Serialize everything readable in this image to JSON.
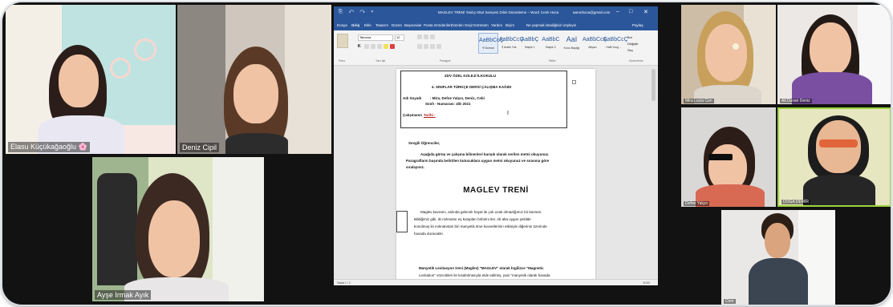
{
  "participants": {
    "p1": {
      "name": "Elasu Küçükağaoğlu 🌸"
    },
    "p2": {
      "name": "Deniz Cipil"
    },
    "p3": {
      "name": "Ayşe Irmak Ayık"
    },
    "p4": {
      "name": "Mira Lucia Cen"
    },
    "p5": {
      "name": "All Duvan Deniz"
    },
    "p6": {
      "name": "Defne Yalçın"
    },
    "p7": {
      "name": "DOĞA DEMİR"
    },
    "p8": {
      "name": "Cem"
    }
  },
  "word": {
    "title": "MAGLEV TRENİ Yanlış Okul Seviyesi Dilini Düzenleme – Word",
    "user": "Cenk Hoca",
    "account": "aaronhoca@gmail.com",
    "tabs": [
      "Dosya",
      "Giriş",
      "Ekle",
      "Tasarım",
      "Düzen",
      "Başvurular",
      "Posta Gönderileri",
      "Gözden Geçir",
      "Görünüm",
      "Yardım",
      "Biçim",
      "Ne yapmak istediğinizi söyleyin",
      "Paylaş"
    ],
    "clipboard_label": "Pano",
    "font_name": "Tahoma",
    "font_size": "12",
    "font_label": "Yazı tipi",
    "paragraph_label": "Paragraf",
    "styles_label": "Stiller",
    "styles": [
      {
        "preview": "AaBbCcÇ",
        "name": "¶ Normal"
      },
      {
        "preview": "AaBbCcÇ",
        "name": "¶ Aralık Yok"
      },
      {
        "preview": "AaBbÇ",
        "name": "Başlık 1"
      },
      {
        "preview": "AaBbC",
        "name": "Başlık 2"
      },
      {
        "preview": "AaI",
        "name": "Konu Başlığı"
      },
      {
        "preview": "AaBbCcÇ",
        "name": "Altyazı"
      },
      {
        "preview": "AaBbCcÇ",
        "name": "Hafif Vurg..."
      }
    ],
    "editing": {
      "find": "Bul",
      "replace": "Değiştir",
      "select": "Seç"
    },
    "editing_label": "Düzenleme",
    "status_left": "Sayfa 1 / 2",
    "status_right": "%100",
    "doc": {
      "school": "ZDV ÖZEL KOLEJİ İLKOKULU",
      "worksheet": "4. SINIFLAR TÜRKÇE DERSİ ÇALIŞMA KAĞIDI",
      "name_label": "Adı Soyadı",
      "name_value": ": Mira, Defne Yalçın, Deniz, Cebi",
      "class_label": "Sınıfı - Numarası: 4/D 2021",
      "date_label": "Çalışmanın",
      "date_value": "Tarihi :",
      "greeting": "Sevgili Öğrenciler,",
      "instr1": "Aşağıda görüş ve çalışma bilinenleri karışık olarak verilen metni okuyunuz.",
      "instr2": "Paragrafların başında belirtilen kutucuklara uygun metni okuyunuz ve sırasına göre",
      "instr3": "sıralayınız.",
      "title": "MAGLEV TRENİ",
      "p1_l1": "Maglev kavramı, aslında gelecek hayal ile çok uzak olmadığımız bir kavram.",
      "p1_l2": "Bildiğimiz gibi, iki mıknatısı eş kutupları birbirini iter. Alt alta uygun şekilde",
      "p1_l3": "konulmuş iki mıknatıstan biri manyetik itme kuvvetlerinin etkisiyle diğerinin üzerinde",
      "p1_l4": "havada duracaktır.",
      "p2_l1": "Manyetik Levitasyon treni (Maglev) \"MAGLEV\" olarak İngilizce \"Magnetic",
      "p2_l2": "Levitation\" sözcükleri ile kısaltılmasıyla elde edilmiş, yani \"manyetik olarak havada"
    }
  }
}
